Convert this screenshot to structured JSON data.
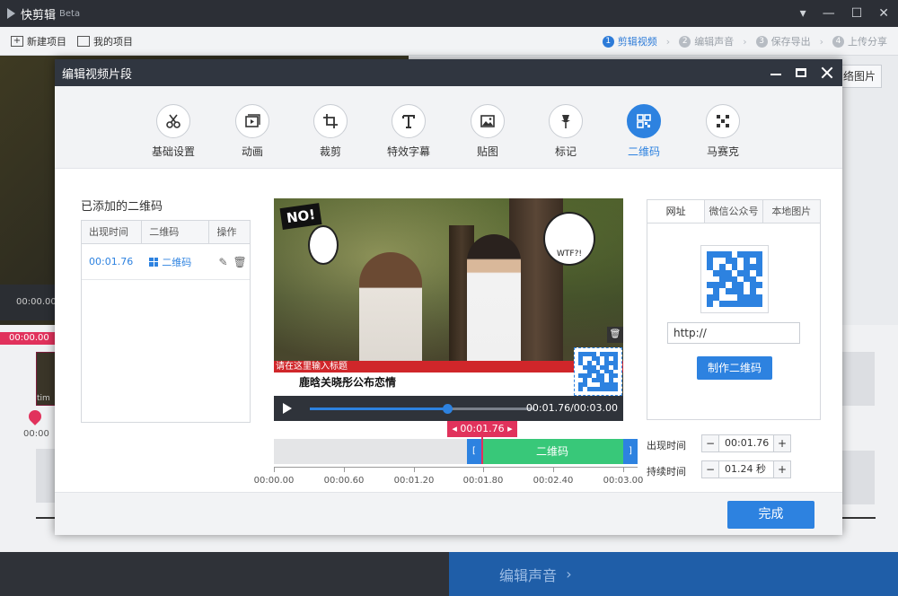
{
  "app": {
    "name": "快剪辑",
    "beta": "Beta",
    "new_project": "新建项目",
    "my_projects": "我的项目",
    "steps": [
      {
        "num": "1",
        "label": "剪辑视频",
        "active": true
      },
      {
        "num": "2",
        "label": "编辑声音",
        "active": false
      },
      {
        "num": "3",
        "label": "保存导出",
        "active": false
      },
      {
        "num": "4",
        "label": "上传分享",
        "active": false
      }
    ],
    "bg_time": "00:00.00",
    "bg_time2": "00:00.00",
    "bg_zero": "00:00",
    "bg_right_btn": "络图片",
    "bg_clip_label": "tim",
    "bottom_next": "编辑声音"
  },
  "modal": {
    "title": "编辑视频片段",
    "tools": [
      {
        "name": "scissors",
        "label": "基础设置"
      },
      {
        "name": "animation",
        "label": "动画"
      },
      {
        "name": "crop",
        "label": "裁剪"
      },
      {
        "name": "text",
        "label": "特效字幕"
      },
      {
        "name": "image",
        "label": "贴图"
      },
      {
        "name": "pin",
        "label": "标记"
      },
      {
        "name": "qrcode",
        "label": "二维码"
      },
      {
        "name": "mosaic",
        "label": "马赛克"
      }
    ],
    "list_title": "已添加的二维码",
    "list_headers": [
      "出现时间",
      "二维码",
      "操作"
    ],
    "list_rows": [
      {
        "time": "00:01.76",
        "qr": "二维码"
      }
    ],
    "preview": {
      "sticker_no": "NO!",
      "sticker_wtf": "WTF?!",
      "caption_title": "请在这里输入标题",
      "caption_text": "鹿晗关晓彤公布恋情",
      "player_time": "00:01.76/00:03.00",
      "progress": 0.61
    },
    "timeline": {
      "cursor_time": "00:01.76",
      "segment_label": "二维码",
      "ticks": [
        "00:00.00",
        "00:00.60",
        "00:01.20",
        "00:01.80",
        "00:02.40",
        "00:03.00"
      ]
    },
    "right_panel": {
      "tabs": [
        "网址",
        "微信公众号",
        "本地图片"
      ],
      "url_value": "http://",
      "make_btn": "制作二维码"
    },
    "fields": {
      "appear_label": "出现时间",
      "appear_value": "00:01.76",
      "duration_label": "持续时间",
      "duration_value": "01.24 秒",
      "minus": "−",
      "plus": "+"
    },
    "done_btn": "完成"
  },
  "colors": {
    "accent": "#2d82e0",
    "highlight": "#e1325c",
    "segment": "#38c879"
  }
}
